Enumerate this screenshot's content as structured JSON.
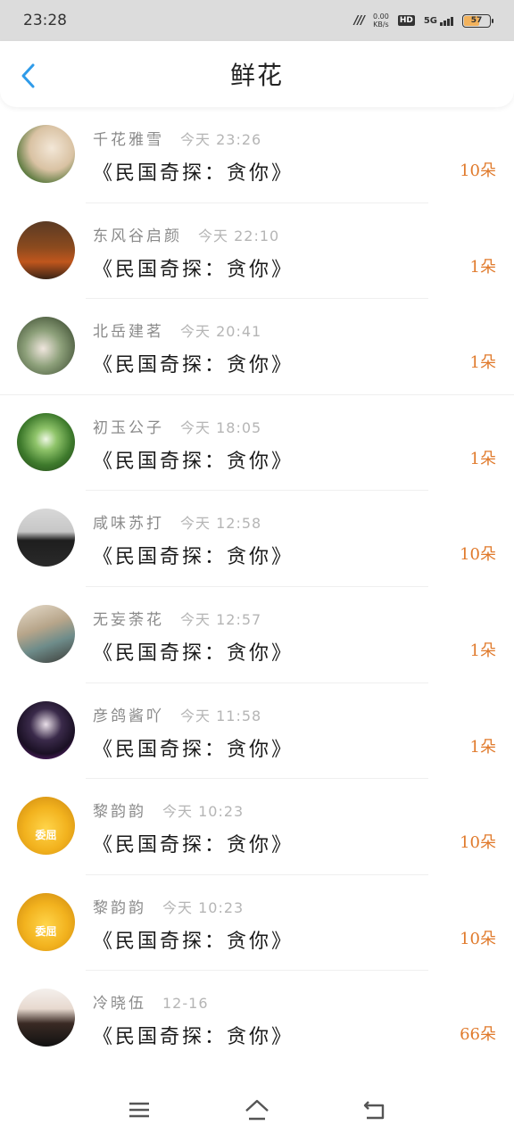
{
  "status": {
    "time": "23:28",
    "net_speed_value": "0.00",
    "net_speed_unit": "KB/s",
    "hd": "HD",
    "network": "5G",
    "battery": "57"
  },
  "header": {
    "title": "鲜花"
  },
  "items": [
    {
      "name": "千花雅雪",
      "time": "今天 23:26",
      "book": "《民国奇探：贪你》",
      "count": "10朵"
    },
    {
      "name": "东风谷启颜",
      "time": "今天 22:10",
      "book": "《民国奇探：贪你》",
      "count": "1朵"
    },
    {
      "name": "北岳建茗",
      "time": "今天 20:41",
      "book": "《民国奇探：贪你》",
      "count": "1朵"
    },
    {
      "name": "初玉公子",
      "time": "今天 18:05",
      "book": "《民国奇探：贪你》",
      "count": "1朵"
    },
    {
      "name": "咸味苏打",
      "time": "今天 12:58",
      "book": "《民国奇探：贪你》",
      "count": "10朵"
    },
    {
      "name": "无妄荼花",
      "time": "今天 12:57",
      "book": "《民国奇探：贪你》",
      "count": "1朵"
    },
    {
      "name": "彦鸽酱吖",
      "time": "今天 11:58",
      "book": "《民国奇探：贪你》",
      "count": "1朵"
    },
    {
      "name": "黎韵韵",
      "time": "今天 10:23",
      "book": "《民国奇探：贪你》",
      "count": "10朵",
      "avatar_text": "委屈"
    },
    {
      "name": "黎韵韵",
      "time": "今天 10:23",
      "book": "《民国奇探：贪你》",
      "count": "10朵",
      "avatar_text": "委屈"
    },
    {
      "name": "冷晓伍",
      "time": "12-16",
      "book": "《民国奇探：贪你》",
      "count": "66朵"
    }
  ],
  "colors": {
    "accent_back": "#2f9be9",
    "count": "#e07a2c"
  }
}
